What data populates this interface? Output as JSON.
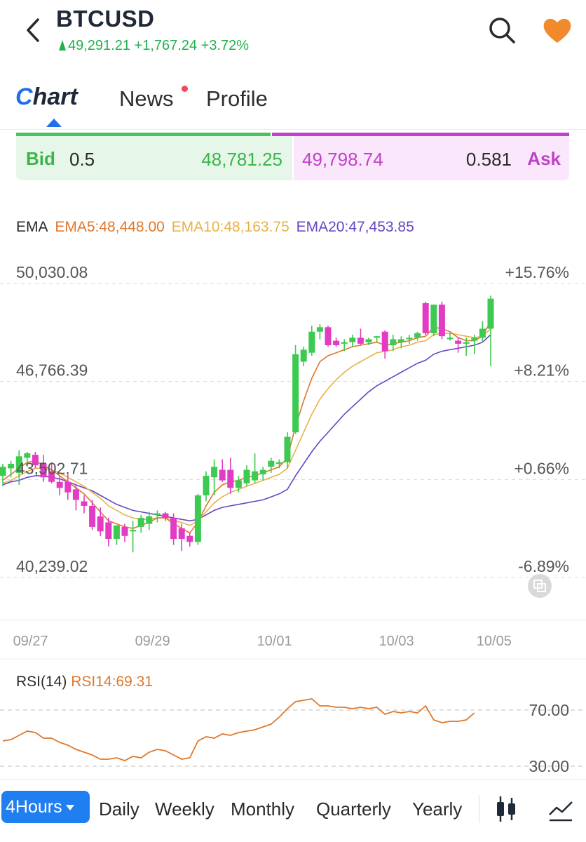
{
  "header": {
    "title": "BTCUSD",
    "price": "49,291.21",
    "change": "+1,767.24",
    "change_pct": "+3.72%",
    "up_color": "#22b24c"
  },
  "tabs": {
    "chart_c": "C",
    "chart_rest": "hart",
    "news": "News",
    "profile": "Profile",
    "active": "chart"
  },
  "bidask": {
    "bid_label": "Bid",
    "bid_size": "0.5",
    "bid_price": "48,781.25",
    "ask_price": "49,798.74",
    "ask_size": "0.581",
    "ask_label": "Ask",
    "bid_color": "#3db54a",
    "ask_color": "#c042c9"
  },
  "ema_legend": {
    "label": "EMA",
    "ema5": "EMA5:48,448.00",
    "ema10": "EMA10:48,163.75",
    "ema20": "EMA20:47,453.85",
    "ema5_color": "#e0772b",
    "ema10_color": "#e8b24a",
    "ema20_color": "#6547c4"
  },
  "chart_data": [
    {
      "type": "candlestick",
      "title": "",
      "y_labels_left": [
        "50,030.08",
        "46,766.39",
        "43,502.71",
        "40,239.02"
      ],
      "y_labels_right": [
        "+15.76%",
        "+8.21%",
        "+0.66%",
        "-6.89%"
      ],
      "ylim": [
        40239.02,
        50030.08
      ],
      "x_tick_labels": [
        "09/27",
        "09/29",
        "10/01",
        "10/03",
        "10/05"
      ],
      "x_tick_index": [
        1,
        16,
        31,
        46,
        58
      ],
      "up_color": "#3dca50",
      "down_color": "#e23bc4",
      "candles": [
        {
          "o": 43250,
          "h": 43650,
          "l": 42900,
          "c": 43550
        },
        {
          "o": 43500,
          "h": 43750,
          "l": 43200,
          "c": 43650
        },
        {
          "o": 43350,
          "h": 44100,
          "l": 42950,
          "c": 43900
        },
        {
          "o": 43850,
          "h": 44050,
          "l": 43550,
          "c": 44000
        },
        {
          "o": 43950,
          "h": 44050,
          "l": 43500,
          "c": 43600
        },
        {
          "o": 43650,
          "h": 43950,
          "l": 43050,
          "c": 43200
        },
        {
          "o": 43400,
          "h": 43700,
          "l": 43000,
          "c": 43050
        },
        {
          "o": 43050,
          "h": 43250,
          "l": 42600,
          "c": 42850
        },
        {
          "o": 43050,
          "h": 43300,
          "l": 42450,
          "c": 42700
        },
        {
          "o": 42800,
          "h": 42950,
          "l": 42100,
          "c": 42450
        },
        {
          "o": 42400,
          "h": 42600,
          "l": 42000,
          "c": 42250
        },
        {
          "o": 42250,
          "h": 42450,
          "l": 41450,
          "c": 41550
        },
        {
          "o": 41900,
          "h": 42200,
          "l": 41250,
          "c": 41400
        },
        {
          "o": 41700,
          "h": 41850,
          "l": 40900,
          "c": 41150
        },
        {
          "o": 41150,
          "h": 41600,
          "l": 40950,
          "c": 41600
        },
        {
          "o": 41550,
          "h": 41650,
          "l": 41050,
          "c": 41250
        },
        {
          "o": 41400,
          "h": 41750,
          "l": 40700,
          "c": 41450
        },
        {
          "o": 41550,
          "h": 41950,
          "l": 41350,
          "c": 41850
        },
        {
          "o": 41650,
          "h": 42050,
          "l": 41450,
          "c": 41900
        },
        {
          "o": 41950,
          "h": 42100,
          "l": 41700,
          "c": 42000
        },
        {
          "o": 42000,
          "h": 42050,
          "l": 41750,
          "c": 41850
        },
        {
          "o": 41850,
          "h": 42000,
          "l": 40950,
          "c": 41150
        },
        {
          "o": 41500,
          "h": 41650,
          "l": 40750,
          "c": 41150
        },
        {
          "o": 41250,
          "h": 41350,
          "l": 40900,
          "c": 41050
        },
        {
          "o": 41050,
          "h": 42650,
          "l": 40950,
          "c": 42600
        },
        {
          "o": 42600,
          "h": 43400,
          "l": 42400,
          "c": 43250
        },
        {
          "o": 43200,
          "h": 43800,
          "l": 42600,
          "c": 43550
        },
        {
          "o": 43450,
          "h": 43800,
          "l": 43050,
          "c": 43100
        },
        {
          "o": 43450,
          "h": 43850,
          "l": 42650,
          "c": 42850
        },
        {
          "o": 42850,
          "h": 43250,
          "l": 42700,
          "c": 43100
        },
        {
          "o": 43000,
          "h": 43600,
          "l": 42900,
          "c": 43450
        },
        {
          "o": 43100,
          "h": 44000,
          "l": 43000,
          "c": 43400
        },
        {
          "o": 43300,
          "h": 43550,
          "l": 43100,
          "c": 43450
        },
        {
          "o": 43550,
          "h": 43850,
          "l": 43350,
          "c": 43750
        },
        {
          "o": 43650,
          "h": 43800,
          "l": 43500,
          "c": 43700
        },
        {
          "o": 43700,
          "h": 44700,
          "l": 43500,
          "c": 44550
        },
        {
          "o": 44700,
          "h": 47600,
          "l": 44650,
          "c": 47300
        },
        {
          "o": 47050,
          "h": 47550,
          "l": 46900,
          "c": 47450
        },
        {
          "o": 47350,
          "h": 48250,
          "l": 47250,
          "c": 48050
        },
        {
          "o": 48050,
          "h": 48300,
          "l": 47800,
          "c": 48200
        },
        {
          "o": 48200,
          "h": 48250,
          "l": 47550,
          "c": 47600
        },
        {
          "o": 47750,
          "h": 47850,
          "l": 47550,
          "c": 47600
        },
        {
          "o": 47650,
          "h": 47800,
          "l": 47400,
          "c": 47700
        },
        {
          "o": 47700,
          "h": 47950,
          "l": 47550,
          "c": 47850
        },
        {
          "o": 47850,
          "h": 48150,
          "l": 47600,
          "c": 47650
        },
        {
          "o": 47700,
          "h": 47850,
          "l": 47600,
          "c": 47800
        },
        {
          "o": 47850,
          "h": 47900,
          "l": 47700,
          "c": 47900
        },
        {
          "o": 48050,
          "h": 48100,
          "l": 47150,
          "c": 47400
        },
        {
          "o": 47600,
          "h": 47950,
          "l": 47400,
          "c": 47800
        },
        {
          "o": 47700,
          "h": 47900,
          "l": 47500,
          "c": 47800
        },
        {
          "o": 47800,
          "h": 47950,
          "l": 47650,
          "c": 47850
        },
        {
          "o": 47850,
          "h": 48050,
          "l": 47750,
          "c": 48000
        },
        {
          "o": 49000,
          "h": 49050,
          "l": 47950,
          "c": 48000
        },
        {
          "o": 48000,
          "h": 48950,
          "l": 47900,
          "c": 48950
        },
        {
          "o": 48950,
          "h": 49050,
          "l": 47800,
          "c": 47900
        },
        {
          "o": 47850,
          "h": 48000,
          "l": 47750,
          "c": 47850
        },
        {
          "o": 47750,
          "h": 47850,
          "l": 47350,
          "c": 47650
        },
        {
          "o": 47650,
          "h": 47850,
          "l": 47250,
          "c": 47700
        },
        {
          "o": 47750,
          "h": 47950,
          "l": 47300,
          "c": 47850
        },
        {
          "o": 47850,
          "h": 48400,
          "l": 47700,
          "c": 48150
        },
        {
          "o": 48150,
          "h": 49250,
          "l": 46900,
          "c": 49150
        }
      ],
      "ema5": [
        43100,
        43300,
        43500,
        43700,
        43750,
        43600,
        43450,
        43250,
        43050,
        42850,
        42650,
        42350,
        42050,
        41750,
        41650,
        41550,
        41500,
        41600,
        41700,
        41850,
        41850,
        41650,
        41500,
        41350,
        41700,
        42250,
        42700,
        42950,
        43050,
        43100,
        43200,
        43250,
        43350,
        43450,
        43550,
        43850,
        44900,
        45750,
        46500,
        47050,
        47250,
        47350,
        47450,
        47550,
        47600,
        47650,
        47700,
        47600,
        47650,
        47700,
        47750,
        47850,
        47900,
        48200,
        48150,
        48050,
        47850,
        47750,
        47750,
        47900,
        48400
      ],
      "ema10": [
        43000,
        43100,
        43250,
        43400,
        43500,
        43500,
        43450,
        43350,
        43200,
        43050,
        42900,
        42700,
        42500,
        42250,
        42100,
        41950,
        41850,
        41800,
        41800,
        41850,
        41850,
        41750,
        41700,
        41600,
        41750,
        42050,
        42350,
        42550,
        42700,
        42800,
        42900,
        43000,
        43100,
        43200,
        43300,
        43500,
        44100,
        44700,
        45300,
        45800,
        46150,
        46450,
        46700,
        46900,
        47050,
        47200,
        47350,
        47400,
        47450,
        47550,
        47600,
        47700,
        47750,
        47950,
        48000,
        48000,
        47950,
        47900,
        47850,
        47900,
        48150
      ],
      "ema20": [
        42950,
        43050,
        43100,
        43200,
        43250,
        43250,
        43200,
        43150,
        43050,
        42950,
        42850,
        42750,
        42600,
        42450,
        42300,
        42200,
        42100,
        42050,
        42000,
        41950,
        41900,
        41850,
        41800,
        41750,
        41800,
        41950,
        42100,
        42200,
        42250,
        42300,
        42350,
        42400,
        42450,
        42550,
        42650,
        42800,
        43250,
        43650,
        44050,
        44400,
        44700,
        45000,
        45300,
        45550,
        45800,
        46050,
        46250,
        46400,
        46550,
        46700,
        46850,
        47000,
        47100,
        47300,
        47400,
        47450,
        47500,
        47550,
        47600,
        47700,
        47950
      ]
    },
    {
      "type": "line",
      "title": "",
      "name": "RSI14",
      "y_labels": [
        "70.00",
        "30.00"
      ],
      "ylim": [
        30,
        70
      ],
      "color": "#e0772b",
      "values": [
        48,
        49,
        52,
        55,
        54,
        50,
        50,
        47,
        45,
        42,
        40,
        38,
        35,
        35,
        36,
        34,
        37,
        36,
        40,
        42,
        41,
        38,
        35,
        36,
        48,
        51,
        50,
        53,
        52,
        54,
        55,
        56,
        58,
        60,
        65,
        71,
        76,
        77,
        78,
        73,
        73,
        72,
        72,
        71,
        72,
        71,
        72,
        67,
        69,
        68,
        69,
        68,
        73,
        63,
        61,
        62,
        62,
        63,
        68
      ]
    }
  ],
  "rsi_legend": {
    "label": "RSI(14)",
    "value": "RSI14:69.31",
    "color": "#e0772b"
  },
  "periods": {
    "active": "4Hours",
    "items": [
      "Daily",
      "Weekly",
      "Monthly",
      "Quarterly",
      "Yearly"
    ]
  }
}
